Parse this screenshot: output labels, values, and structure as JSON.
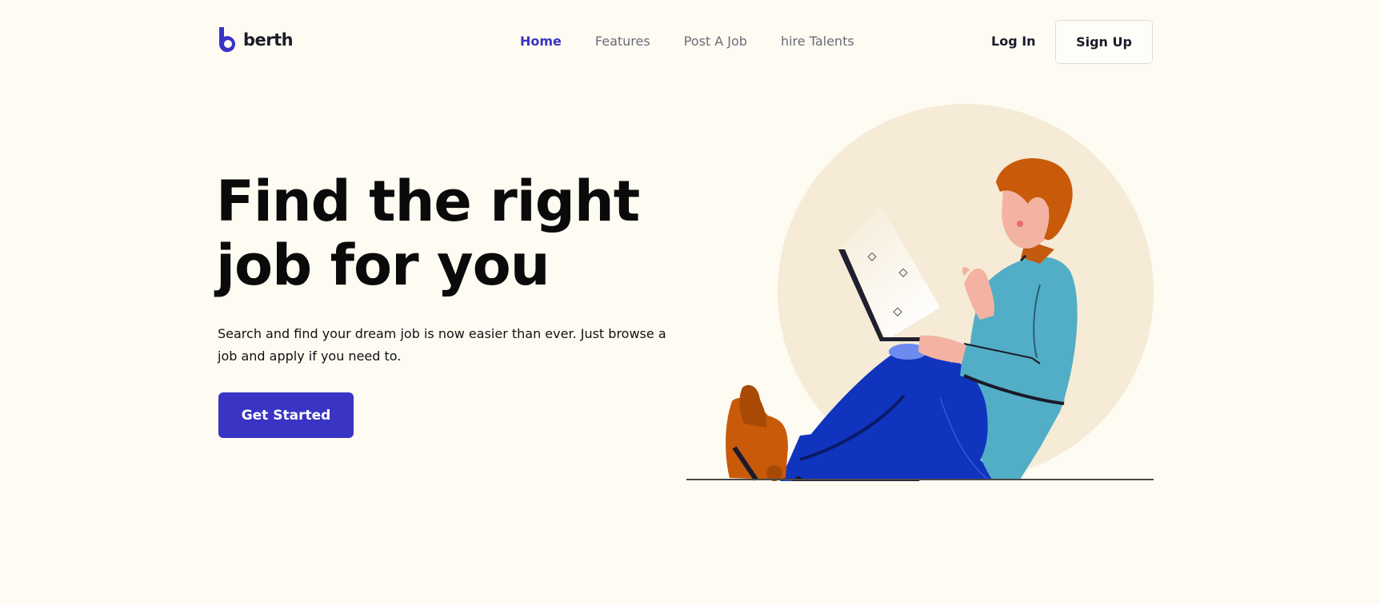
{
  "brand": {
    "name": "berth",
    "color": "#3a34c4"
  },
  "nav": {
    "items": [
      {
        "label": "Home",
        "active": true
      },
      {
        "label": "Features",
        "active": false
      },
      {
        "label": "Post A Job",
        "active": false
      },
      {
        "label": "hire Talents",
        "active": false
      }
    ]
  },
  "auth": {
    "login_label": "Log In",
    "signup_label": "Sign Up"
  },
  "hero": {
    "headline_line1": "Find the right",
    "headline_line2": "job for you",
    "subtext": "Search and find your dream job is now easier than ever. Just browse a job and apply if you need to.",
    "cta_label": "Get Started",
    "illustration": "person-sitting-with-laptop-illustration"
  },
  "colors": {
    "background": "#fefbf2",
    "accent": "#3a34c4",
    "circle": "#f5ebd6",
    "shirt": "#52aec6",
    "pants": "#1134be",
    "hair": "#c95a0a"
  }
}
